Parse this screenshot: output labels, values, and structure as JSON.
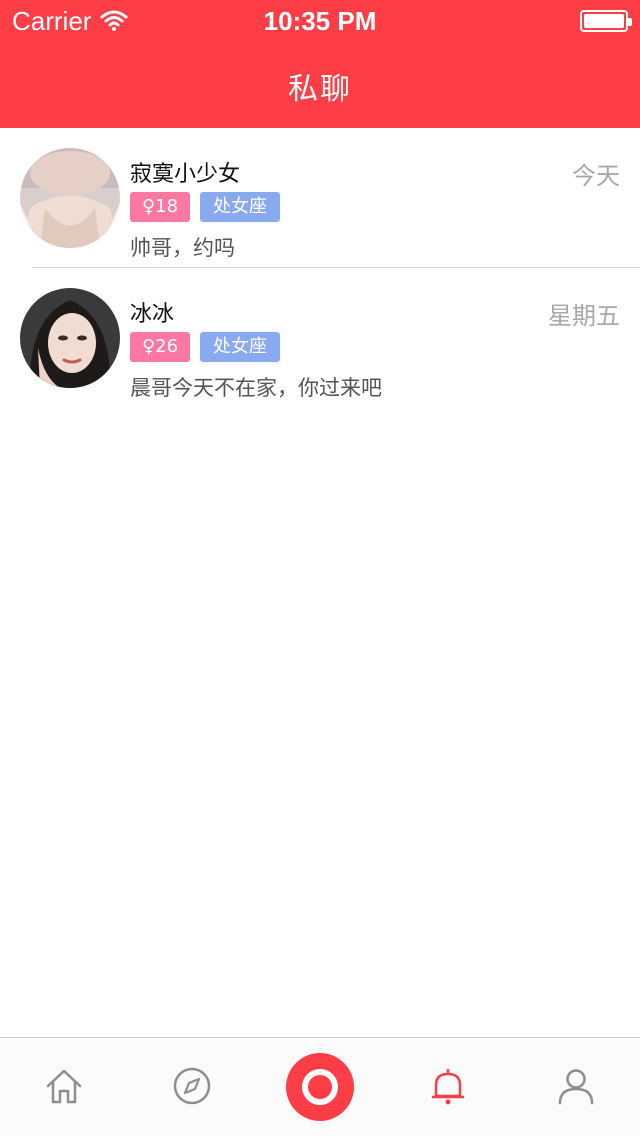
{
  "status_bar": {
    "carrier": "Carrier",
    "time": "10:35 PM"
  },
  "header": {
    "title": "私聊"
  },
  "conversations": [
    {
      "name": "寂寞小少女",
      "date": "今天",
      "age_tag": "♀18",
      "zodiac_tag": "处女座",
      "message": "帅哥，约吗"
    },
    {
      "name": "冰冰",
      "date": "星期五",
      "age_tag": "♀26",
      "zodiac_tag": "处女座",
      "message": "晨哥今天不在家，你过来吧"
    }
  ],
  "tabbar": {
    "items": [
      {
        "icon": "home-icon",
        "active": false
      },
      {
        "icon": "compass-icon",
        "active": false
      },
      {
        "icon": "record-icon",
        "active": false
      },
      {
        "icon": "bell-icon",
        "active": true
      },
      {
        "icon": "profile-icon",
        "active": false
      }
    ]
  },
  "colors": {
    "brand": "#fd3e47",
    "age_tag": "#fb78a3",
    "zodiac_tag": "#8aaaf0",
    "inactive_icon": "#8e8e8e"
  }
}
